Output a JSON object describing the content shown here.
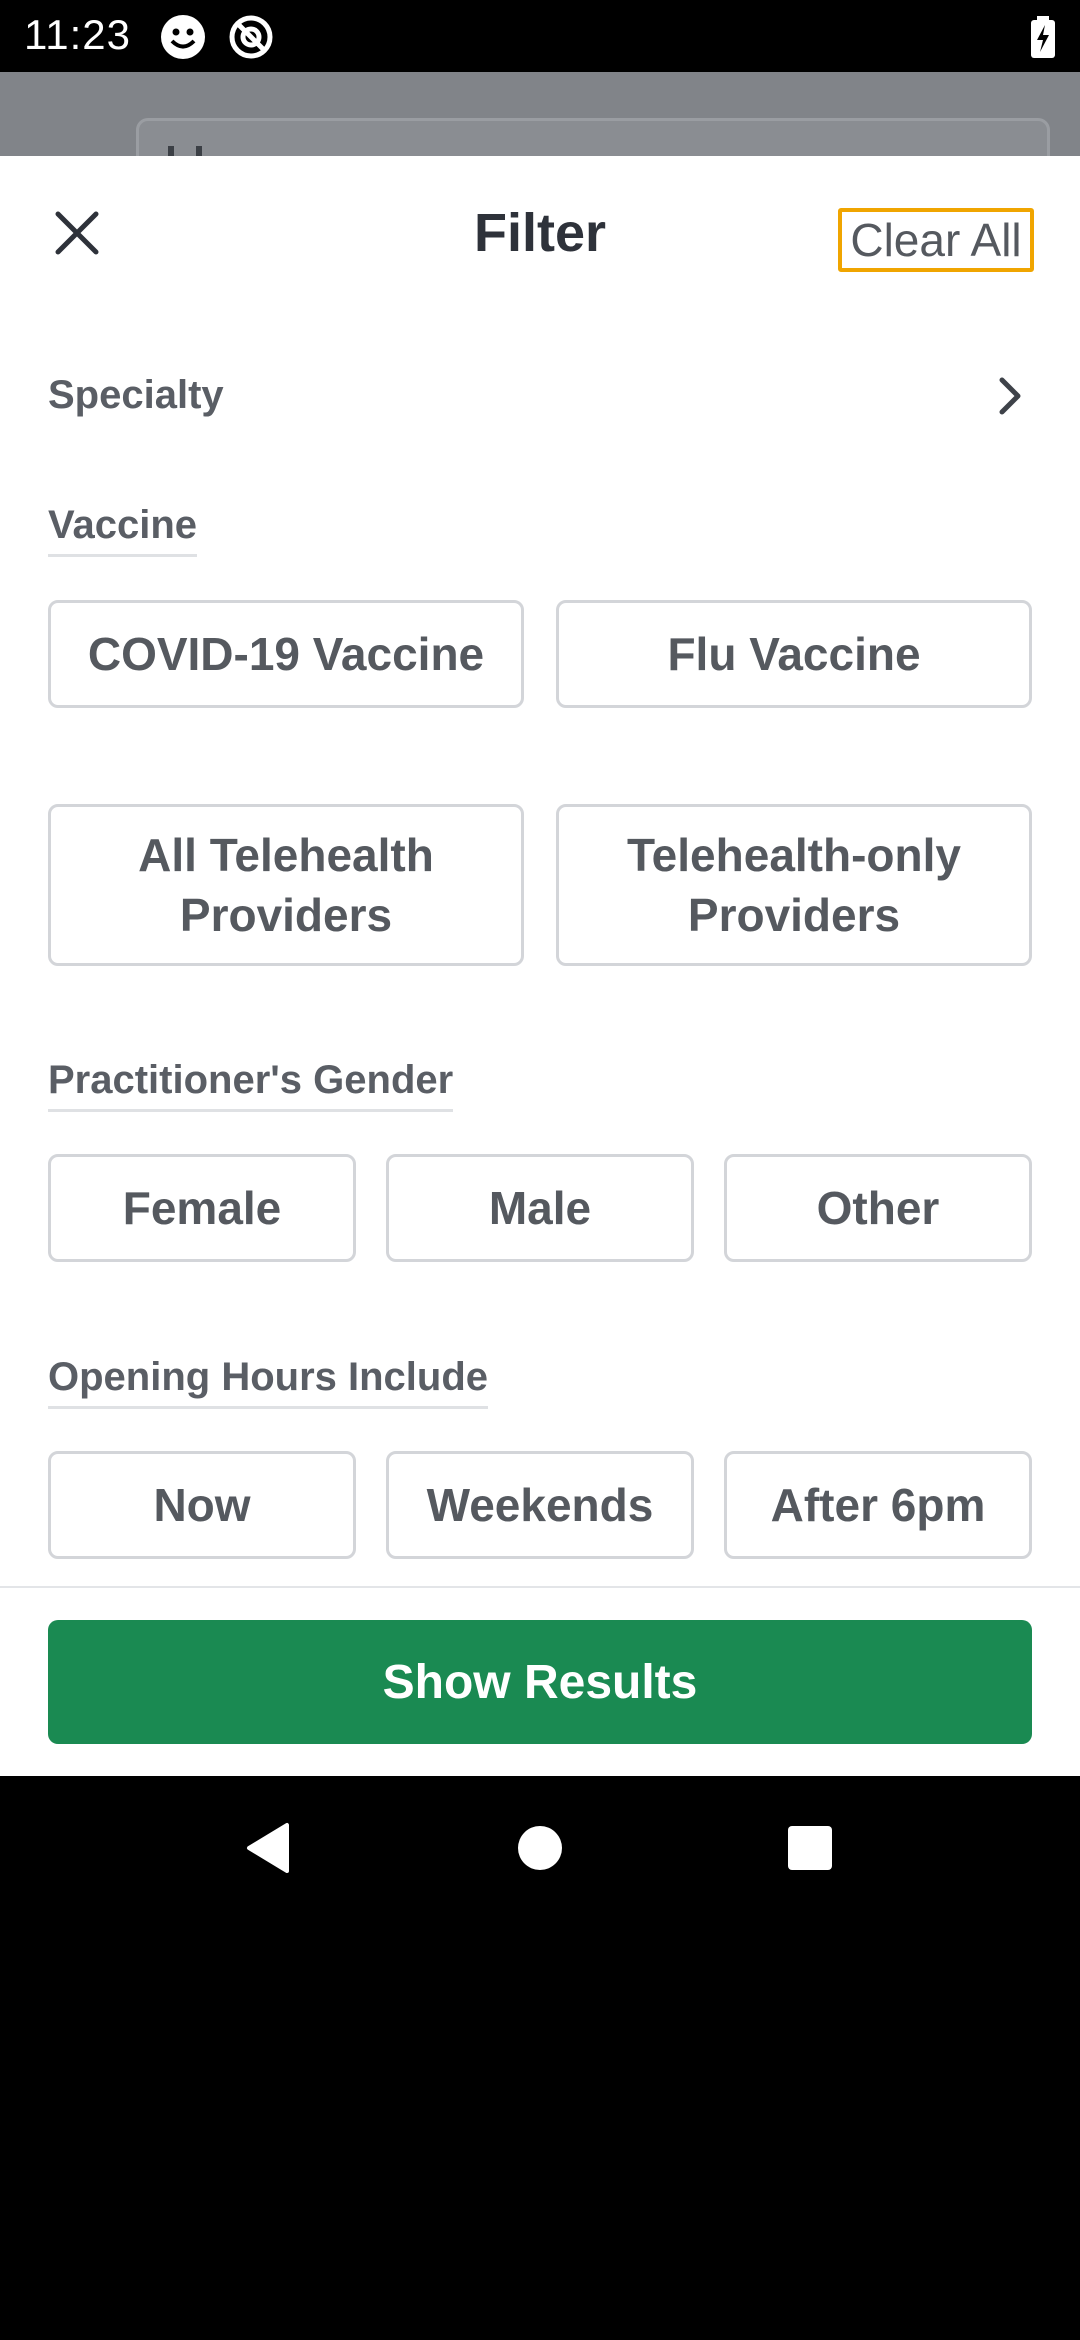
{
  "status_bar": {
    "time": "11:23",
    "icons": [
      "smiley-icon",
      "at-sign-icon",
      "battery-charging-icon"
    ]
  },
  "filter": {
    "title": "Filter",
    "clear_all": "Clear All",
    "close_icon": "close-icon",
    "specialty": {
      "label": "Specialty",
      "icon": "chevron-right-icon"
    },
    "vaccine": {
      "heading": "Vaccine",
      "options": [
        "COVID-19 Vaccine",
        "Flu Vaccine"
      ]
    },
    "telehealth": {
      "options": [
        "All Telehealth Providers",
        "Telehealth-only Providers"
      ]
    },
    "gender": {
      "heading": "Practitioner's Gender",
      "options": [
        "Female",
        "Male",
        "Other"
      ]
    },
    "hours": {
      "heading": "Opening Hours Include",
      "options": [
        "Now",
        "Weekends",
        "After 6pm"
      ]
    },
    "show_results": "Show Results"
  },
  "nav_bar": {
    "icons": [
      "back-icon",
      "home-icon",
      "recents-icon"
    ]
  },
  "colors": {
    "accent_green": "#1a8a52",
    "focus_outline": "#f0a500",
    "text_dark": "#2e323a",
    "text_muted": "#5a5e65"
  }
}
